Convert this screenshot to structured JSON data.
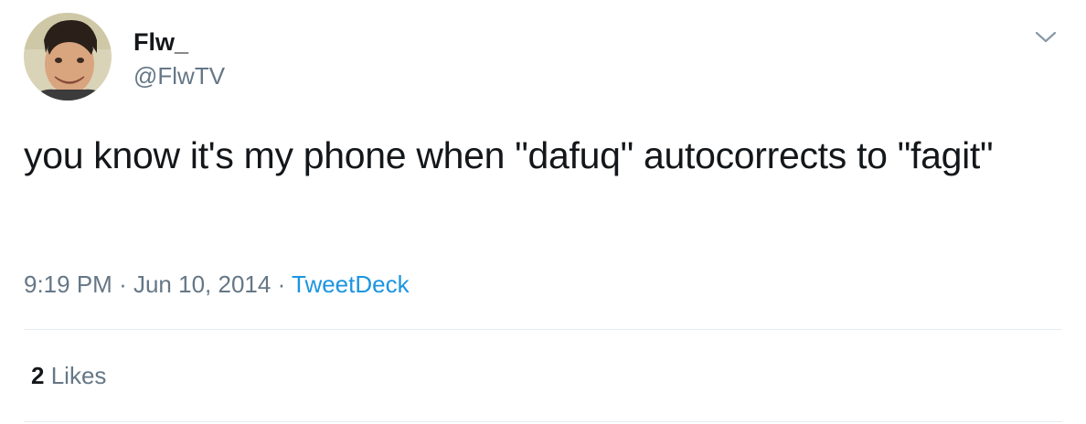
{
  "author": {
    "display_name": "Flw_",
    "handle": "@FlwTV",
    "avatar_icon": "profile-photo"
  },
  "menu": {
    "icon": "chevron-down-icon"
  },
  "tweet": {
    "text": "you know it's my phone when \"dafuq\" autocorrects to \"fagit\""
  },
  "meta": {
    "time": "9:19 PM",
    "separator": "·",
    "date": "Jun 10, 2014",
    "source": "TweetDeck"
  },
  "stats": {
    "likes_count": "2",
    "likes_label": "Likes"
  },
  "colors": {
    "text": "#14171a",
    "secondary": "#657786",
    "link": "#1b95e0",
    "divider": "#e6ecf0"
  }
}
